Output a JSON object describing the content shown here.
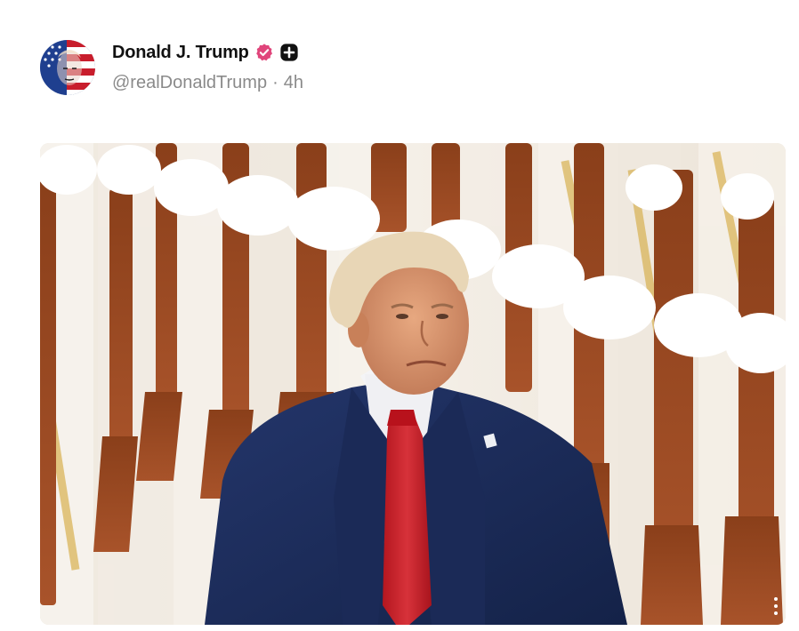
{
  "post": {
    "author": {
      "display_name": "Donald J. Trump",
      "handle": "@realDonaldTrump",
      "separator": "·",
      "time_ago": "4h"
    },
    "icons": {
      "verified": "verified-badge-icon",
      "plus_badge": "plus-badge-icon",
      "more": "more-vertical-icon"
    },
    "colors": {
      "verified": "#e0457b",
      "name": "#111111",
      "meta": "#8a8a8a",
      "suit": "#1b2a55",
      "tie": "#c8202a"
    },
    "media": {
      "kind": "photo"
    }
  }
}
